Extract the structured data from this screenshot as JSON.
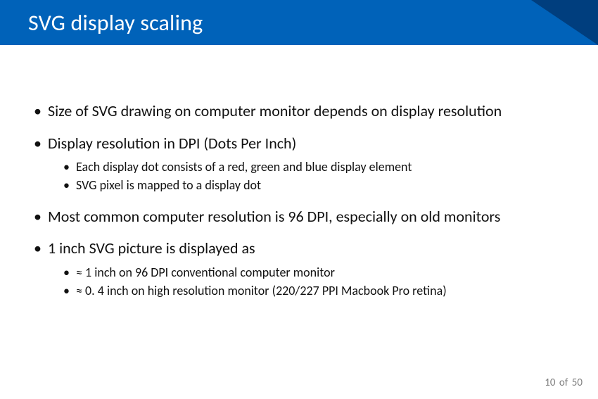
{
  "title": "SVG display scaling",
  "bullets": {
    "b1": "Size of SVG drawing on computer monitor depends on display resolution",
    "b2": "Display resolution in DPI (Dots Per Inch)",
    "b2_sub": {
      "s1": "Each display dot consists of a red, green and blue display element",
      "s2": "SVG pixel is mapped to a display dot"
    },
    "b3": "Most common computer resolution is 96 DPI, especially on old monitors",
    "b4": "1 inch SVG picture is displayed as",
    "b4_sub": {
      "s1": "≈ 1 inch on 96 DPI conventional computer monitor",
      "s2": "≈ 0. 4 inch on high resolution monitor (220/227 PPI Macbook Pro retina)"
    }
  },
  "footer": {
    "current": "10",
    "of": "of",
    "total": "50"
  }
}
